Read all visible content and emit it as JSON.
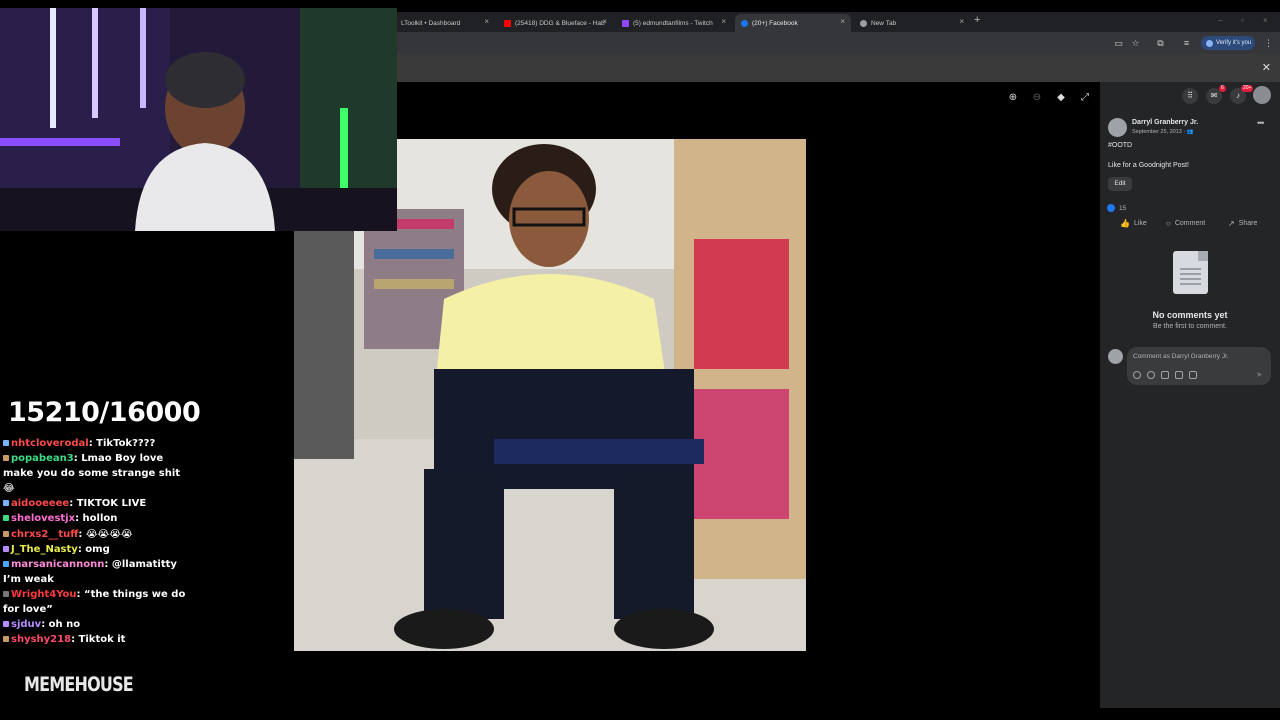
{
  "browser": {
    "tabs": [
      {
        "label": "LToolkit • Dashboard",
        "color": "#5f6368",
        "active": false
      },
      {
        "label": "(25418) DDG & Blueface - Hab",
        "color": "#ff0000",
        "active": false
      },
      {
        "label": "(5) edmundtanfilms - Twitch",
        "color": "#9146ff",
        "active": false
      },
      {
        "label": "(20+) Facebook",
        "color": "#1877f2",
        "active": true
      },
      {
        "label": "New Tab",
        "color": "#9aa0a6",
        "active": false
      }
    ],
    "new_tab_symbol": "+",
    "verify_label": "Verify it's you"
  },
  "viewer": {
    "tool_icons": [
      "zoom-in-icon",
      "zoom-out-icon",
      "tag-icon",
      "fullscreen-icon"
    ]
  },
  "facebook": {
    "messenger_badge": "6",
    "notifications_badge": "20+",
    "post": {
      "author": "Darryl Granberry Jr.",
      "date": "September 25, 2013 · ",
      "hashtag": "#OOTD",
      "caption": "Like for a Goodnight Post!",
      "edit_label": "Edit",
      "reaction_count": "15"
    },
    "actions": {
      "like": "Like",
      "comment": "Comment",
      "share": "Share"
    },
    "no_comments_title": "No comments yet",
    "no_comments_sub": "Be the first to comment.",
    "comment_placeholder": "Comment as Darryl Granberry Jr.",
    "accent": "#2078f4"
  },
  "stream": {
    "counter": "15210/16000",
    "chat": [
      {
        "user": "nhtcloverodal",
        "color": "#ff4a4a",
        "msg": "TikTok????"
      },
      {
        "user": "popabean3",
        "color": "#3ddc84",
        "msg": "Lmao Boy love make you do some strange shit 😂"
      },
      {
        "user": "aidooeeee",
        "color": "#ff4a4a",
        "msg": "TIKTOK LIVE"
      },
      {
        "user": "shelovestjx",
        "color": "#ff6fd1",
        "msg": "hollon"
      },
      {
        "user": "chrxs2__tuff",
        "color": "#ff4a4a",
        "msg": "😭😭😭😭"
      },
      {
        "user": "J_The_Nasty",
        "color": "#e7e94a",
        "msg": "omg"
      },
      {
        "user": "marsanicannonn",
        "color": "#ff8ad8",
        "msg": "@llamatitty I’m weak"
      },
      {
        "user": "Wright4You",
        "color": "#ff3b3b",
        "msg": "“the things we do for love”"
      },
      {
        "user": "sjduv",
        "color": "#b58cff",
        "msg": "oh no"
      },
      {
        "user": "shyshy218",
        "color": "#ff4a6a",
        "msg": "Tiktok it"
      }
    ],
    "watermark": "MEMEHOUSE"
  }
}
